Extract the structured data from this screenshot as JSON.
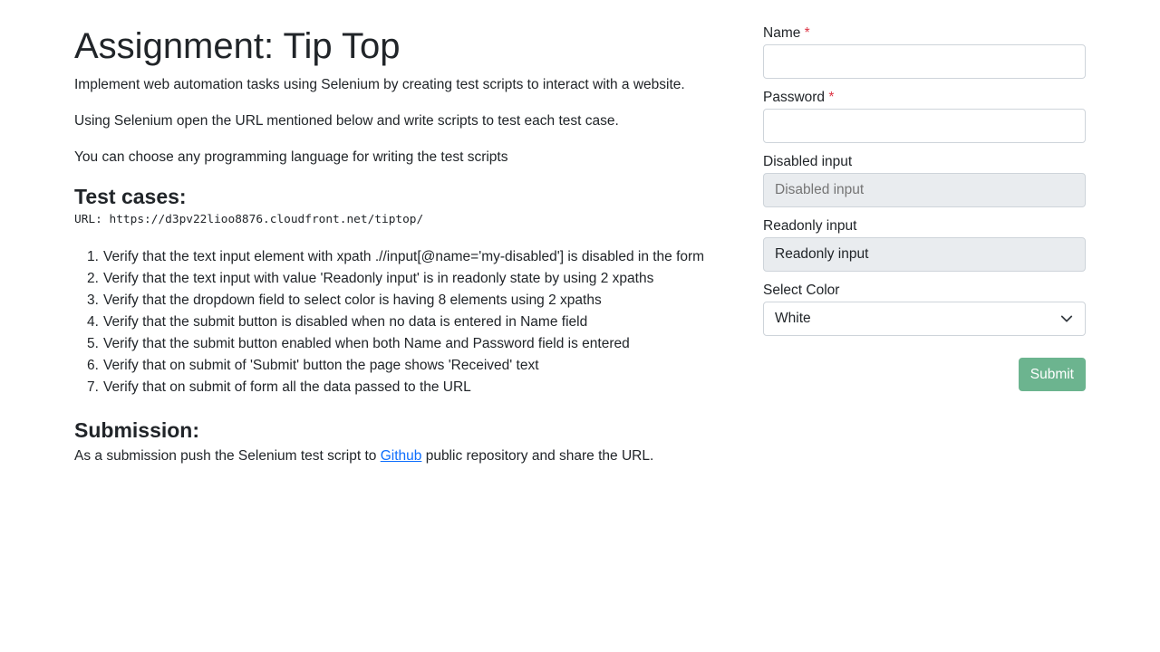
{
  "header": {
    "title": "Assignment: Tip Top"
  },
  "intro": {
    "p1": "Implement web automation tasks using Selenium by creating test scripts to interact with a website.",
    "p2": "Using Selenium open the URL mentioned below and write scripts to test each test case.",
    "p3": "You can choose any programming language for writing the test scripts"
  },
  "test_cases": {
    "heading": "Test cases:",
    "url": "URL: https://d3pv22lioo8876.cloudfront.net/tiptop/",
    "items": [
      {
        "num": "1.",
        "text": "Verify that the text input element with xpath .//input[@name='my-disabled'] is disabled in the form"
      },
      {
        "num": "2.",
        "text": "Verify that the text input with value 'Readonly input' is in readonly state by using 2 xpaths"
      },
      {
        "num": "3.",
        "text": "Verify that the dropdown field to select color is having 8 elements using 2 xpaths"
      },
      {
        "num": "4.",
        "text": "Verify that the submit button is disabled when no data is entered in Name field"
      },
      {
        "num": "5.",
        "text": "Verify that the submit button enabled when both Name and Password field is entered"
      },
      {
        "num": "6.",
        "text": "Verify that on submit of 'Submit' button the page shows 'Received' text"
      },
      {
        "num": "7.",
        "text": "Verify that on submit of form all the data passed to the URL"
      }
    ]
  },
  "submission": {
    "heading": "Submission:",
    "before_link": "As a submission push the Selenium test script to ",
    "link_text": "Github",
    "after_link": " public repository and share the URL."
  },
  "form": {
    "name_label": "Name",
    "password_label": "Password",
    "required_mark": "*",
    "name_value": "",
    "password_value": "",
    "disabled_label": "Disabled input",
    "disabled_placeholder": "Disabled input",
    "readonly_label": "Readonly input",
    "readonly_value": "Readonly input",
    "select_label": "Select Color",
    "select_value": "White",
    "submit_label": "Submit"
  },
  "colors": {
    "submit_button": "#6cb48f",
    "required": "#dc3545",
    "link": "#0d6efd",
    "disabled_bg": "#e9ecef"
  }
}
